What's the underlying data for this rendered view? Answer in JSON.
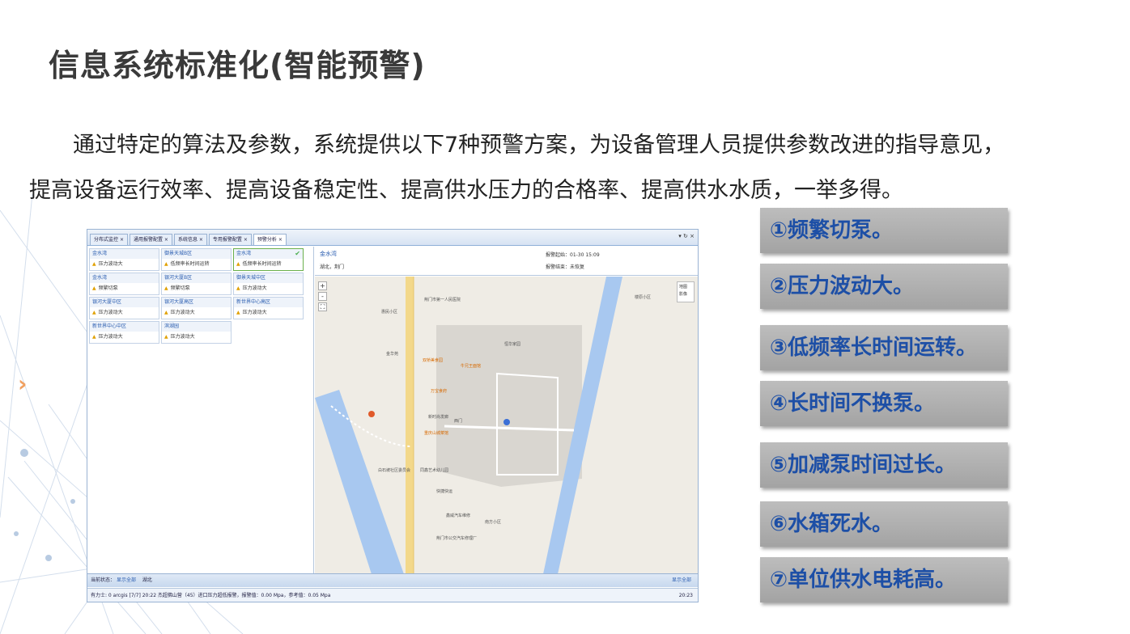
{
  "slide": {
    "title": "信息系统标准化(智能预警)",
    "intro_line1": "通过特定的算法及参数，系统提供以下7种预警方案，为设备管理人员提供参数改进的指导意见，",
    "intro_line2": "提高设备运行效率、提高设备稳定性、提高供水压力的合格率、提高供水水质，一举多得。",
    "arrow_icon": "chevron-right-icon"
  },
  "app": {
    "tabs": [
      {
        "label": "分布式监控",
        "close": "×"
      },
      {
        "label": "通用报警配置",
        "close": "×"
      },
      {
        "label": "系统信息",
        "close": "×"
      },
      {
        "label": "专用报警配置",
        "close": "×"
      },
      {
        "label": "预警分析",
        "close": "×"
      }
    ],
    "tab_controls": "▾ ↻ ×",
    "cards": [
      {
        "title": "金水湾",
        "alert": "压力波动大"
      },
      {
        "title": "御景天城B区",
        "alert": "低频率长时间运转"
      },
      {
        "title": "金水湾",
        "alert": "低频率长时间运转",
        "check": "✔"
      },
      {
        "title": "金水湾",
        "alert": "频繁切泵"
      },
      {
        "title": "银河大厦B区",
        "alert": "频繁切泵"
      },
      {
        "title": "御景天城中区",
        "alert": "压力波动大"
      },
      {
        "title": "银河大厦中区",
        "alert": "压力波动大"
      },
      {
        "title": "银河大厦高区",
        "alert": "压力波动大"
      },
      {
        "title": "新世界中心高区",
        "alert": "压力波动大"
      },
      {
        "title": "新世界中心中区",
        "alert": "压力波动大"
      },
      {
        "title": "滨湖园",
        "alert": "压力波动大"
      }
    ],
    "warn_glyph": "▲",
    "info": {
      "name": "金水湾",
      "sub": "湖北，荆门",
      "time_label": "报警起始：01-30 15:09",
      "state_label": "报警结束：未恢复"
    },
    "map_labels": [
      "荆门市第一人民医院",
      "西门",
      "惠民小区",
      "南方小区",
      "荆门市公交汽车修理厂",
      "白石坡社区委员会",
      "同鑫艺术幼儿园",
      "重庆山城菜馆",
      "万宝食府",
      "双桥美食园",
      "牛兄王面馆",
      "新时尚发廊",
      "鑫威汽车维修",
      "快捷快运",
      "金华苑",
      "楼原小区",
      "恒华家园"
    ],
    "zoom_plus": "+",
    "zoom_minus": "-",
    "fullscreen": "⛶",
    "maptype": {
      "a": "地图",
      "b": "影像"
    },
    "footbar": {
      "label": "当前状态：",
      "link": "显示全部",
      "mid": "湖北",
      "right": "显示全部"
    },
    "statusbar": {
      "text": "有力士: 0 arcgis   [7/7]   20:22 杰超佛山营（45）进口压力超低报警，报警值：0.00 Mpa，参考值：0.05 Mpa",
      "time": "20:23"
    }
  },
  "warnings": [
    "①频繁切泵。",
    "②压力波动大。",
    "③低频率长时间运转。",
    "④长时间不换泵。",
    "⑤加减泵时间过长。",
    "⑥水箱死水。",
    "⑦单位供水电耗高。"
  ],
  "colors": {
    "accent": "#1d4fa6",
    "box": "#b0b0b0",
    "arrow": "#f0a060"
  }
}
